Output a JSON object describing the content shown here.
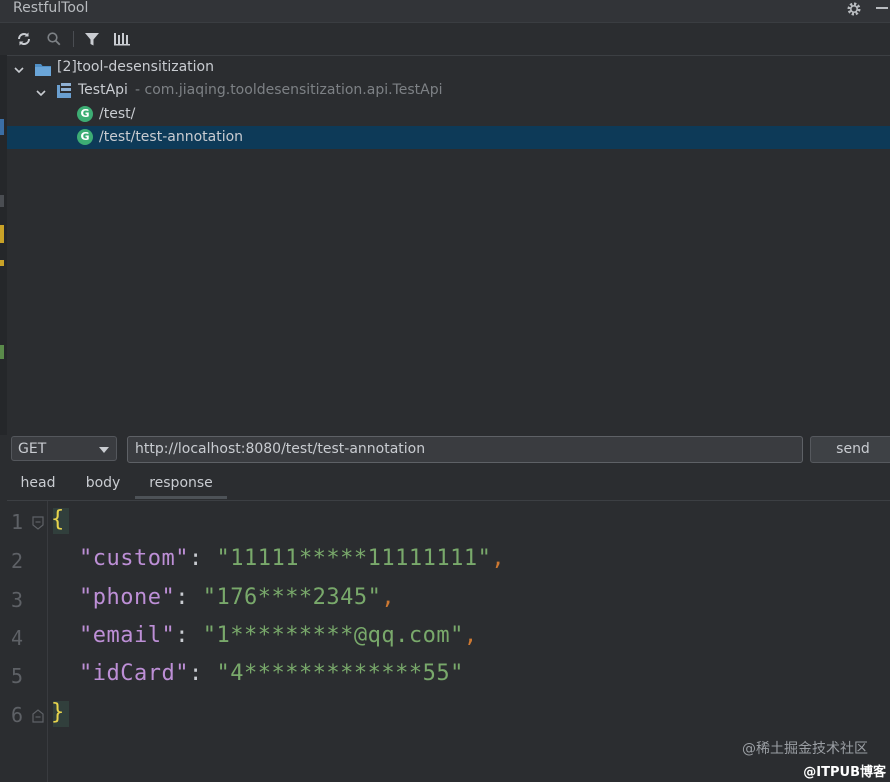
{
  "window": {
    "title": "RestfulTool"
  },
  "toolbar": {
    "icons": [
      "refresh-icon",
      "search-icon",
      "filter-icon",
      "library-icon"
    ]
  },
  "tree": {
    "module": "[2]tool-desensitization",
    "controller": {
      "name": "TestApi",
      "package": "- com.jiaqing.tooldesensitization.api.TestApi"
    },
    "endpoints": [
      {
        "method_badge": "G",
        "path": "/test/"
      },
      {
        "method_badge": "G",
        "path": "/test/test-annotation"
      }
    ]
  },
  "request": {
    "method": "GET",
    "url": "http://localhost:8080/test/test-annotation",
    "send_label": "send"
  },
  "tabs": [
    {
      "label": "head"
    },
    {
      "label": "body"
    },
    {
      "label": "response"
    }
  ],
  "response": {
    "line_numbers": [
      "1",
      "2",
      "3",
      "4",
      "5",
      "6"
    ],
    "open_brace": "{",
    "close_brace": "}",
    "fields": [
      {
        "key": "\"custom\"",
        "value": "\"11111*****11111111\"",
        "comma": ","
      },
      {
        "key": "\"phone\"",
        "value": "\"176****2345\"",
        "comma": ","
      },
      {
        "key": "\"email\"",
        "value": "\"1*********@qq.com\"",
        "comma": ","
      },
      {
        "key": "\"idCard\"",
        "value": "\"4*************55\"",
        "comma": ""
      }
    ]
  },
  "watermark": {
    "line1": "@稀土掘金技术社区",
    "line2": "@ITPUB博客"
  },
  "colors": {
    "selected_row": "#0d3a58",
    "badge_green": "#3dad74",
    "json_key": "#bd8fd6",
    "json_string": "#79a96b",
    "json_brace": "#e8d44d",
    "json_comma": "#cc7832"
  }
}
